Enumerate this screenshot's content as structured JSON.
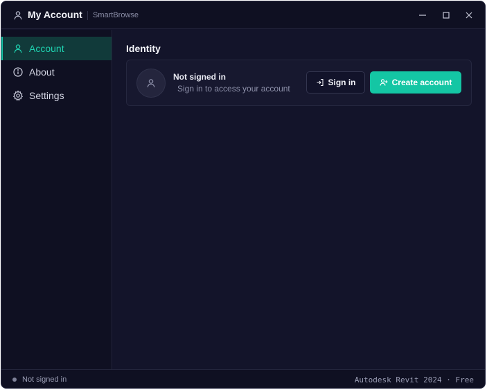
{
  "titlebar": {
    "title": "My Account",
    "subtitle": "SmartBrowse",
    "icons": {
      "app": "user-icon",
      "minimize": "minimize-icon",
      "maximize": "maximize-icon",
      "close": "close-icon"
    }
  },
  "sidebar": {
    "items": [
      {
        "label": "Account",
        "icon": "user-icon",
        "active": true
      },
      {
        "label": "About",
        "icon": "info-icon",
        "active": false
      },
      {
        "label": "Settings",
        "icon": "gear-icon",
        "active": false
      }
    ]
  },
  "main": {
    "section_title": "Identity",
    "card": {
      "title": "Not signed in",
      "subtitle": "Sign in to access your account",
      "signin_label": "Sign in",
      "create_label": "Create account"
    }
  },
  "statusbar": {
    "left": "Not signed in",
    "right": "Autodesk Revit 2024 · Free"
  },
  "colors": {
    "accent": "#14c6a4",
    "background": "#13142a",
    "sidebar": "#0f1022"
  }
}
